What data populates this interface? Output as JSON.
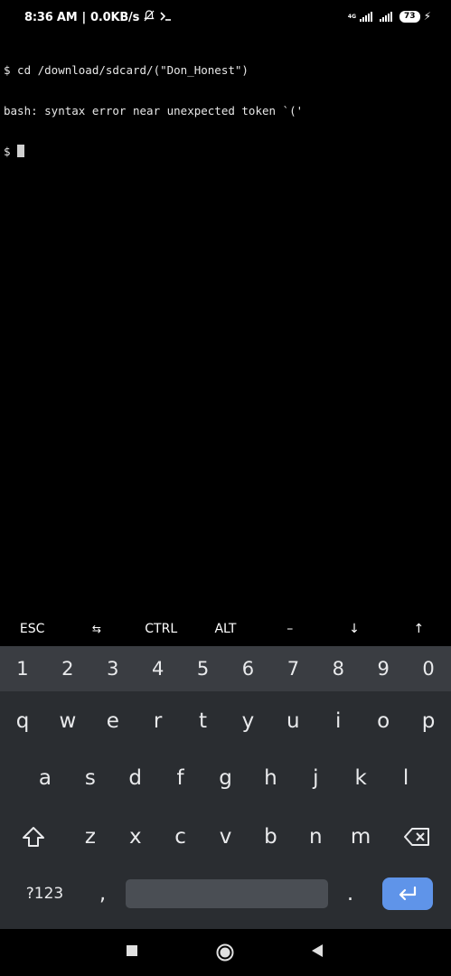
{
  "status": {
    "time": "8:36 AM",
    "separator": "|",
    "speed": "0.0KB/s",
    "network": "4G",
    "battery": "73"
  },
  "terminal": {
    "lines": [
      "$ cd /download/sdcard/(\"Don_Honest\")",
      "bash: syntax error near unexpected token `('",
      "$ "
    ]
  },
  "extra_keys": [
    "ESC",
    "⇆",
    "CTRL",
    "ALT",
    "–",
    "↓",
    "↑"
  ],
  "keyboard": {
    "numbers": [
      "1",
      "2",
      "3",
      "4",
      "5",
      "6",
      "7",
      "8",
      "9",
      "0"
    ],
    "row1": [
      "q",
      "w",
      "e",
      "r",
      "t",
      "y",
      "u",
      "i",
      "o",
      "p"
    ],
    "row2": [
      "a",
      "s",
      "d",
      "f",
      "g",
      "h",
      "j",
      "k",
      "l"
    ],
    "row3": [
      "z",
      "x",
      "c",
      "v",
      "b",
      "n",
      "m"
    ],
    "sym_label": "?123",
    "comma": ",",
    "period": "."
  }
}
